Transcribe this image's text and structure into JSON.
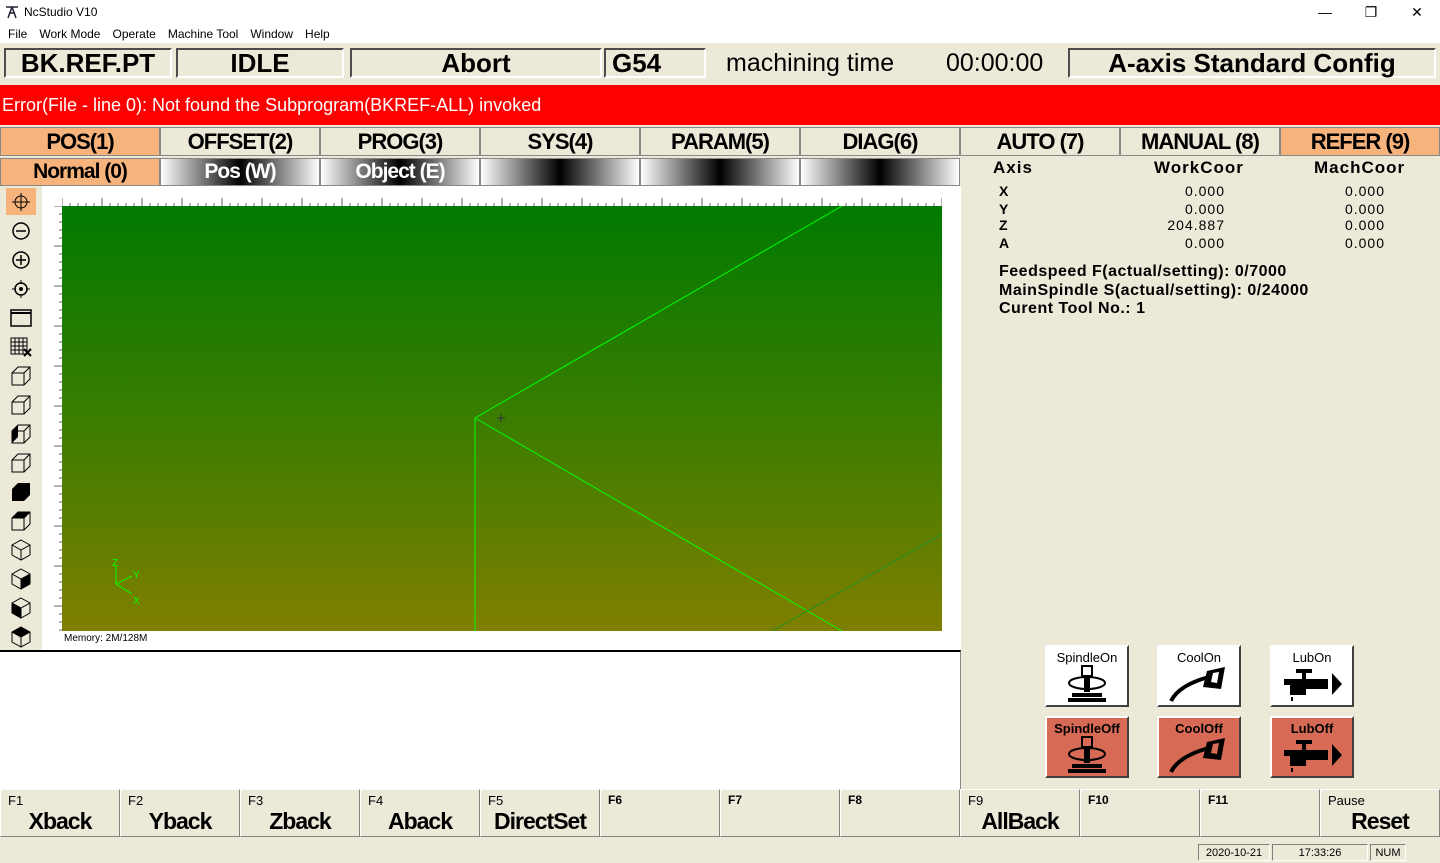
{
  "window": {
    "title": "NcStudio V10",
    "controls": [
      "—",
      "❐",
      "✕"
    ]
  },
  "menu": [
    "File",
    "Work Mode",
    "Operate",
    "Machine Tool",
    "Window",
    "Help"
  ],
  "status": {
    "mode": "BK.REF.PT",
    "state": "IDLE",
    "abort": "Abort",
    "coord": "G54",
    "time_label": "machining time",
    "time_value": "00:00:00",
    "config": "A-axis Standard Config"
  },
  "error": "Error(File - line 0): Not found the Subprogram(BKREF-ALL) invoked",
  "tabs": [
    "POS(1)",
    "OFFSET(2)",
    "PROG(3)",
    "SYS(4)",
    "PARAM(5)",
    "DIAG(6)",
    "AUTO (7)",
    "MANUAL (8)",
    "REFER (9)"
  ],
  "subtabs": [
    "Normal (0)",
    "Pos (W)",
    "Object (E)",
    "",
    "",
    ""
  ],
  "canvas": {
    "memory": "Memory: 2M/128M",
    "axis_labels": [
      "Z",
      "Y",
      "X"
    ]
  },
  "coords": {
    "headers": [
      "Axis",
      "WorkCoor",
      "MachCoor"
    ],
    "rows": [
      {
        "axis": "X",
        "work": "0.000",
        "mach": "0.000"
      },
      {
        "axis": "Y",
        "work": "0.000",
        "mach": "0.000"
      },
      {
        "axis": "Z",
        "work": "204.887",
        "mach": "0.000"
      },
      {
        "axis": "A",
        "work": "0.000",
        "mach": "0.000"
      }
    ]
  },
  "info": {
    "feed": "Feedspeed F(actual/setting):  0/7000",
    "spindle": "MainSpindle S(actual/setting):  0/24000",
    "tool": "Curent Tool No.:  1"
  },
  "controls": {
    "spindle_on": "SpindleOn",
    "cool_on": "CoolOn",
    "lub_on": "LubOn",
    "spindle_off": "SpindleOff",
    "cool_off": "CoolOff",
    "lub_off": "LubOff"
  },
  "fkeys": [
    {
      "key": "F1",
      "name": "Xback"
    },
    {
      "key": "F2",
      "name": "Yback"
    },
    {
      "key": "F3",
      "name": "Zback"
    },
    {
      "key": "F4",
      "name": "Aback"
    },
    {
      "key": "F5",
      "name": "DirectSet"
    },
    {
      "key": "F6",
      "name": ""
    },
    {
      "key": "F7",
      "name": ""
    },
    {
      "key": "F8",
      "name": ""
    },
    {
      "key": "F9",
      "name": "AllBack"
    },
    {
      "key": "F10",
      "name": ""
    },
    {
      "key": "F11",
      "name": ""
    },
    {
      "key": "Pause",
      "name": "Reset"
    }
  ],
  "statusbar": {
    "date": "2020-10-21",
    "time": "17:33:26",
    "num": "NUM"
  },
  "colors": {
    "error": "#ff0000",
    "active_tab": "#f7b37c",
    "off_button": "#d76a55",
    "toolpath": "#00ff00"
  }
}
